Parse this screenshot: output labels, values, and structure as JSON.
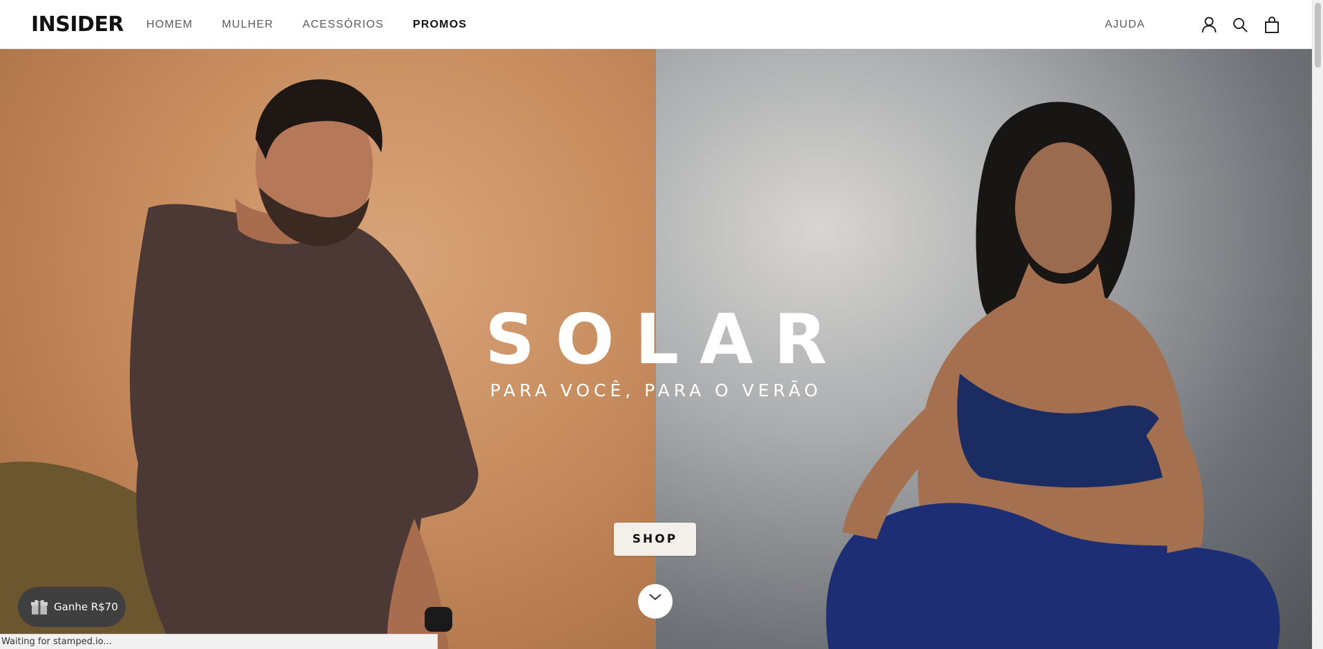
{
  "header": {
    "logo": "INSIDER",
    "nav": [
      "HOMEM",
      "MULHER",
      "ACESSÓRIOS",
      "PROMOS"
    ],
    "help": "AJUDA",
    "icons": [
      "account-icon",
      "search-icon",
      "cart-icon"
    ]
  },
  "hero": {
    "title": "SOLAR",
    "subtitle": "PARA VOCÊ, PARA O VERÃO",
    "cta": "SHOP"
  },
  "promo": {
    "gift_label": "Ganhe R$70"
  },
  "status_bar": {
    "text": "Waiting for stamped.io..."
  },
  "colors": {
    "left_bg": "#c98f61",
    "right_bg": "#8a8d91",
    "shirt": "#4a3634",
    "outfit": "#1c2f6e"
  }
}
